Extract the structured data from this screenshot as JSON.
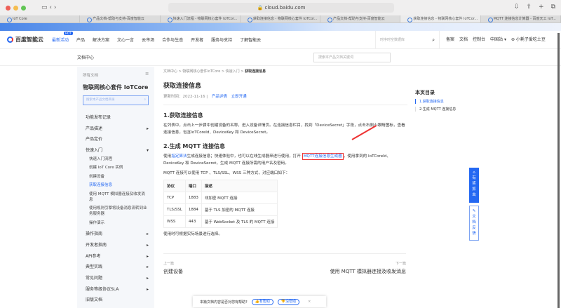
{
  "browser": {
    "url": "cloud.baidu.com",
    "tabs": [
      "IoT Core",
      "产品文档-帮助与支持-百度智能云",
      "快速入门流程 - 物联网核心套件 IoTCor...",
      "获取连接信息 - 物联网核心套件 IoTCor...",
      "产品文档-帮助与支持-百度智能云",
      "获取连接信息 - 物联网核心套件 IoTCor...",
      "MQTT 连接信息计算器 - 百度天工 IoT..."
    ]
  },
  "nav": {
    "logo": "百度智能云",
    "hot": "HOT",
    "items": [
      "最新活动",
      "产品",
      "解决方案",
      "文心一言",
      "云市场",
      "合作与生态",
      "开发者",
      "服务与支持",
      "了解智能云"
    ],
    "search_placeholder": "时序时空数据库",
    "right": [
      "备案",
      "文档",
      "控制台",
      "中国站 ▾"
    ],
    "user": "小耗子爱吃土豆"
  },
  "doc_center": {
    "title": "文档中心",
    "search_placeholder": "搜索本产品文档关键词"
  },
  "sidebar": {
    "all_docs": "所有文档",
    "product": "物联网核心套件 IoTCore",
    "search_placeholder": "搜索本产品文档目录",
    "items_top": [
      {
        "label": "功能发布记录",
        "arrow": ""
      },
      {
        "label": "产品描述",
        "arrow": "▸"
      },
      {
        "label": "产品定价",
        "arrow": ""
      },
      {
        "label": "快速入门",
        "arrow": "▾"
      }
    ],
    "subs": [
      "快速入门流程",
      "创建 IoT Core 实例",
      "创建设备",
      "获取连接信息",
      "使用 MQTT 模拟器连接及收发消息",
      "使用规则引擎将设备消息流转到业务服务器",
      "操作演示"
    ],
    "items_bottom": [
      "操作指南",
      "开发者指南",
      "API参考",
      "典型实践",
      "常见问题",
      "服务等级协议SLA",
      "旧版文档"
    ]
  },
  "main": {
    "breadcrumb": [
      "文档中心",
      "物联网核心套件IoTCore",
      "快速入门",
      "获取连接信息"
    ],
    "sep": ">",
    "title": "获取连接信息",
    "updated": "更新时间：2022-11-16",
    "link1": "产品详情",
    "link2": "立即开通",
    "h1": "1.获取连接信息",
    "p1": "在列表中，点击上一步骤中创建设备的名称，进入设备详情页。在连接信息栏目，找到「DeviceSecret」字段，点击右侧小眼睛图标，查看连接信息，包含IoTCoreId、DeviceKey 和 DeviceSecret。",
    "h2": "2.生成 MQTT 连接信息",
    "p2a": "使用",
    "p2link": "指定算法",
    "p2b": "生成连接信息；快速体验中，也可以在线生成器来进行使用，打开 ",
    "p2link2": "MQTT连接信息生成器",
    "p2c": "，使用拿到的 IoTCoreId、DeviceKey 和 DeviceSecret，生成 MQTT 连接所需的用户名及密码。",
    "p3": "MQTT 连接可以使用 TCP 、TLS/SSL、WSS 三种方式，对应端口如下：",
    "table": {
      "headers": [
        "协议",
        "端口",
        "描述"
      ],
      "rows": [
        [
          "TCP",
          "1883",
          "非加密 MQTT 连接"
        ],
        [
          "TLS/SSL",
          "1884",
          "基于 TLS 加密的 MQTT 连接"
        ],
        [
          "WSS",
          "443",
          "基于 WebSocket 及 TLS 的 MQTT 连接"
        ]
      ]
    },
    "p4": "使用时可根据实际场景进行选择。",
    "prev_label": "上一篇",
    "prev": "创建设备",
    "next_label": "下一篇",
    "next": "使用 MQTT 模拟器连接及收发消息"
  },
  "toc": {
    "title": "本页目录",
    "items": [
      "1.获取连接信息",
      "2.生成 MQTT 连接信息"
    ]
  },
  "float": {
    "a": "有奖抓虫",
    "b": "文档反馈"
  },
  "feedback": {
    "q": "本篇文档内容是否对您有帮助?",
    "yes": "有帮助",
    "no": "没帮助",
    "close": "×"
  }
}
